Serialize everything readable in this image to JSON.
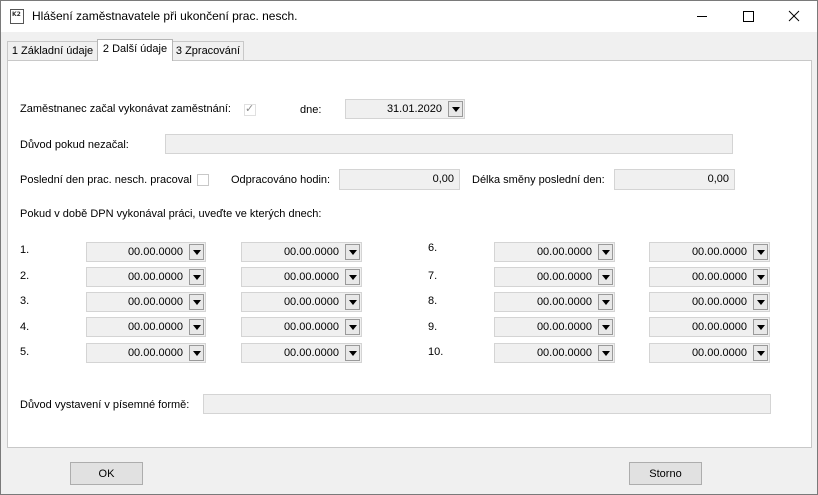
{
  "window": {
    "app_icon_text": "K2",
    "title": "Hlášení zaměstnavatele při ukončení prac. nesch."
  },
  "tabs": [
    {
      "label": "1 Základní údaje"
    },
    {
      "label": "2 Další údaje"
    },
    {
      "label": "3 Zpracování"
    }
  ],
  "form": {
    "started_label": "Zaměstnanec začal vykonávat zaměstnání:",
    "started_checked": true,
    "started_check_glyph": "✓",
    "date_label": "dne:",
    "date_value": "31.01.2020",
    "reason_not_started_label": "Důvod pokud nezačal:",
    "reason_not_started_value": "",
    "last_day_label": "Poslední den prac. nesch. pracoval",
    "last_day_checked": false,
    "hours_label": "Odpracováno hodin:",
    "hours_value": "0,00",
    "shift_label": "Délka směny poslední den:",
    "shift_value": "0,00",
    "dpn_label": "Pokud  v době DPN vykonával práci, uveďte ve kterých dnech:",
    "rows": [
      {
        "num": "1.",
        "from": "00.00.0000",
        "to": "00.00.0000"
      },
      {
        "num": "2.",
        "from": "00.00.0000",
        "to": "00.00.0000"
      },
      {
        "num": "3.",
        "from": "00.00.0000",
        "to": "00.00.0000"
      },
      {
        "num": "4.",
        "from": "00.00.0000",
        "to": "00.00.0000"
      },
      {
        "num": "5.",
        "from": "00.00.0000",
        "to": "00.00.0000"
      },
      {
        "num": "6.",
        "from": "00.00.0000",
        "to": "00.00.0000"
      },
      {
        "num": "7.",
        "from": "00.00.0000",
        "to": "00.00.0000"
      },
      {
        "num": "8.",
        "from": "00.00.0000",
        "to": "00.00.0000"
      },
      {
        "num": "9.",
        "from": "00.00.0000",
        "to": "00.00.0000"
      },
      {
        "num": "10.",
        "from": "00.00.0000",
        "to": "00.00.0000"
      }
    ],
    "written_reason_label": "Důvod vystavení v písemné formě:",
    "written_reason_value": ""
  },
  "buttons": {
    "ok": "OK",
    "cancel": "Storno"
  }
}
